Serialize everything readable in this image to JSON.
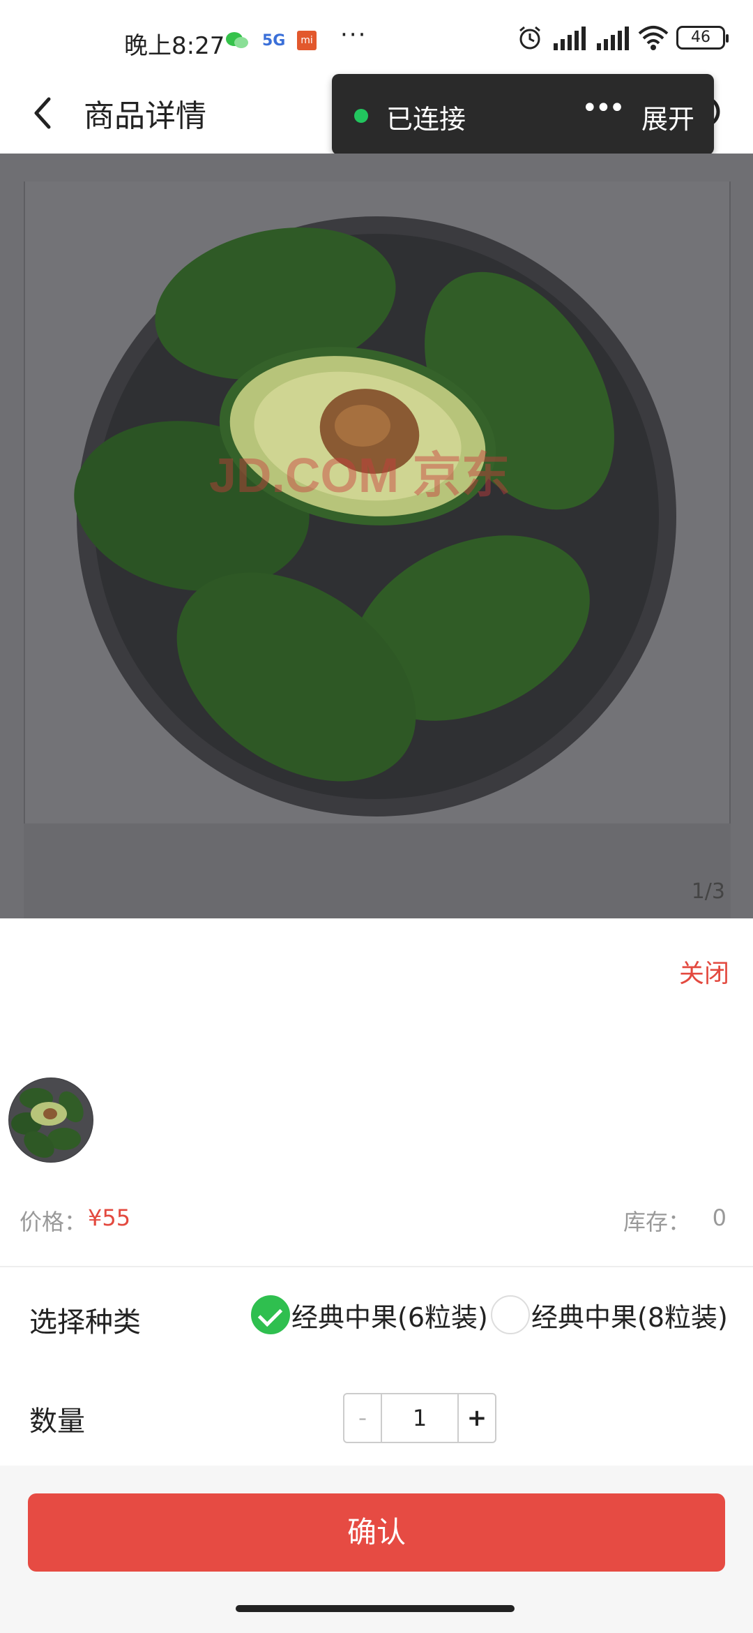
{
  "status_bar": {
    "time": "晚上8:27",
    "network_badge": "5G",
    "mi_badge": "mi",
    "more": "···",
    "battery": "46"
  },
  "header": {
    "title": "商品详情"
  },
  "toast": {
    "status": "已连接",
    "expand": "展开",
    "dots": "•••",
    "dot_color": "#22c55e"
  },
  "gallery": {
    "watermark": "JD.COM 京东",
    "counter": "1/3"
  },
  "sheet": {
    "close_label": "关闭",
    "price_label": "价格：",
    "price_value": "¥55",
    "stock_label": "库存：",
    "stock_value": "0",
    "variant_label": "选择种类",
    "variants": [
      {
        "label": "经典中果(6粒装)",
        "selected": true
      },
      {
        "label": "经典中果(8粒装)",
        "selected": false
      }
    ],
    "quantity_label": "数量",
    "quantity": {
      "minus": "-",
      "value": "1",
      "plus": "+"
    },
    "confirm_label": "确认"
  },
  "colors": {
    "accent_red": "#e64b43",
    "check_green": "#2fbf4f"
  }
}
